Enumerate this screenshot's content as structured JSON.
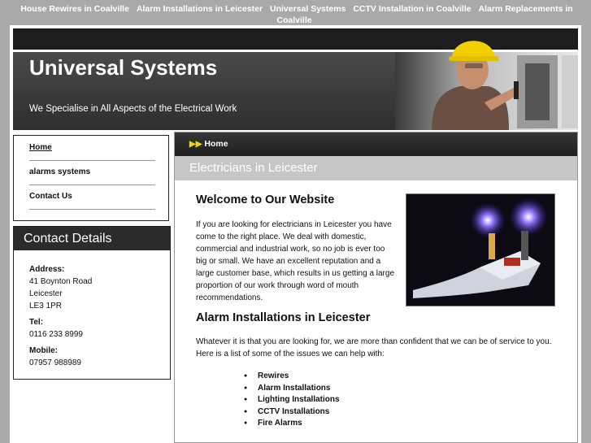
{
  "top_nav": [
    "House Rewires in Coalville",
    "Alarm Installations in Leicester",
    "Universal Systems",
    "CCTV Installation in Coalville",
    "Alarm Replacements in Coalville"
  ],
  "header": {
    "title": "Universal Systems",
    "tagline": "We Specialise in All Aspects of the Electrical Work"
  },
  "sidebar": {
    "menu": [
      "Home",
      "alarms systems",
      "Contact Us"
    ],
    "contact": {
      "heading": "Contact Details",
      "address_label": "Address:",
      "address_lines": [
        "41 Boynton Road",
        "Leicester",
        "LE3 1PR"
      ],
      "tel_label": "Tel:",
      "tel": "0116 233 8999",
      "mobile_label": "Mobile:",
      "mobile": "07957 988989"
    }
  },
  "main": {
    "breadcrumb": "Home",
    "banner": "Electricians in Leicester",
    "welcome_heading": "Welcome to Our Website",
    "welcome_text": "If you are looking for electricians in Leicester you have come to the right place. We deal with domestic, commercial and industrial work, so no job is ever too big or small. We have an excellent reputation and a large customer base, which results in us getting a large proportion of our work through word of mouth recommendations.",
    "alarm_heading": "Alarm Installations in Leicester",
    "alarm_text": "Whatever it is that you are looking for, we are more than confident that we can be of service to you. Here is a list of some of the issues we can help with:",
    "services": [
      "Rewires",
      "Alarm Installations",
      "Lighting Installations",
      "CCTV Installations",
      "Fire Alarms"
    ]
  }
}
